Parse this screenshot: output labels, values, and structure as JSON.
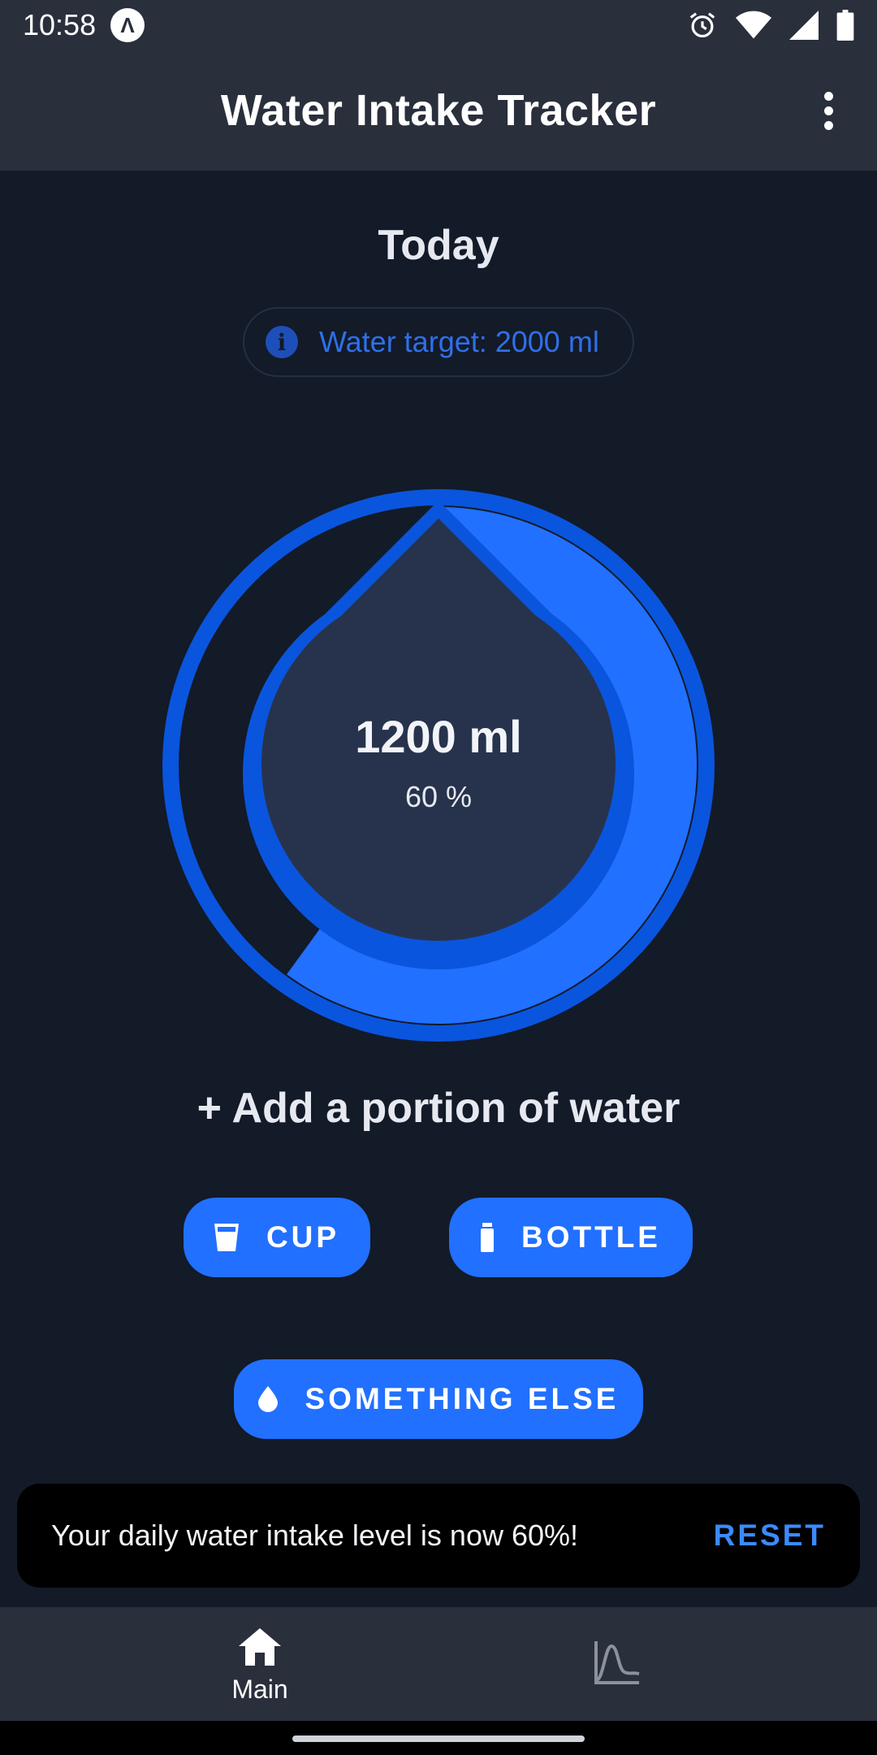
{
  "status_bar": {
    "time": "10:58",
    "app_icon_glyph": "Λ",
    "icons": [
      "alarm-icon",
      "wifi-icon",
      "cell-signal-icon",
      "battery-icon"
    ]
  },
  "app_bar": {
    "title": "Water Intake Tracker",
    "menu_icon": "more-vert-icon"
  },
  "main": {
    "heading": "Today",
    "target_label": "Water target: 2000 ml",
    "gauge": {
      "amount": "1200 ml",
      "percent_label": "60 %",
      "fill_fraction": 0.6
    },
    "add_heading": "+ Add a portion of water",
    "buttons": {
      "cup": "CUP",
      "bottle": "BOTTLE",
      "something_else": "SOMETHING ELSE"
    }
  },
  "snackbar": {
    "message": "Your daily water intake level is now 60%!",
    "action": "RESET"
  },
  "bottom_nav": {
    "main_label": "Main",
    "main_icon": "home-icon",
    "stats_icon": "chart-icon"
  },
  "colors": {
    "background": "#131a28",
    "bar": "#2a2f3c",
    "accent": "#2170ff",
    "ring": "#0a55dd",
    "drop": "#27334d"
  }
}
